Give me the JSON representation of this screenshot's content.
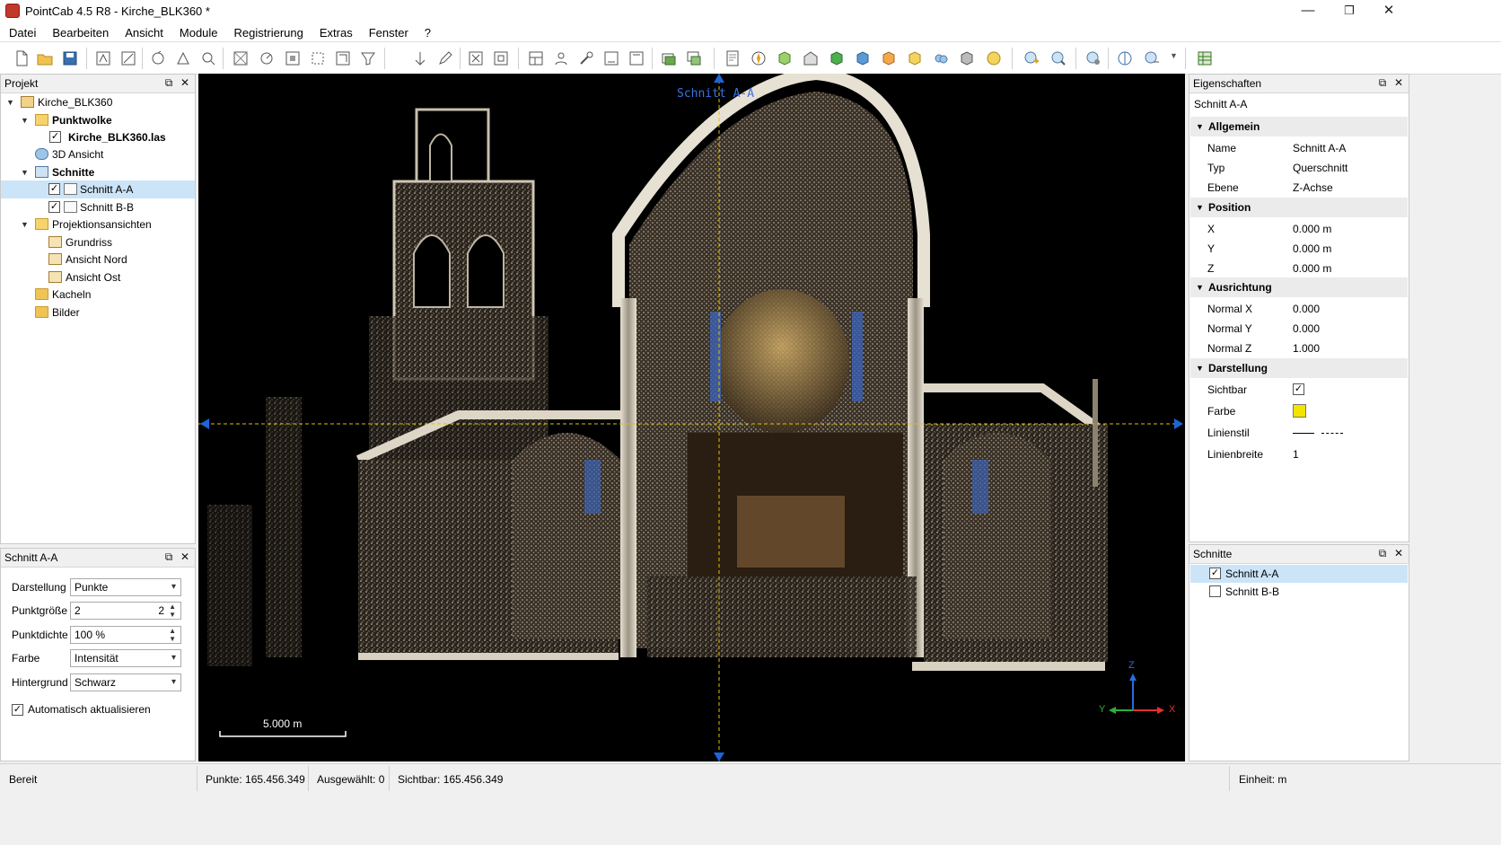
{
  "window": {
    "title": "PointCab 4.5 R8 - Kirche_BLK360 *",
    "minimize": "—",
    "maximize": "❐",
    "close": "✕"
  },
  "menu": [
    "Datei",
    "Bearbeiten",
    "Ansicht",
    "Module",
    "Registrierung",
    "Extras",
    "Fenster",
    "?"
  ],
  "project_panel": {
    "title": "Projekt",
    "tree": {
      "root": "Kirche_BLK360",
      "pointcloud_folder": "Punktwolke",
      "pointcloud_file": "Kirche_BLK360.las",
      "view3d": "3D Ansicht",
      "sections_folder": "Schnitte",
      "section_a": "Schnitt A-A",
      "section_b": "Schnitt B-B",
      "projections_folder": "Projektionsansichten",
      "grundriss": "Grundriss",
      "ansicht_nord": "Ansicht Nord",
      "ansicht_ost": "Ansicht Ost",
      "kacheln": "Kacheln",
      "bilder": "Bilder"
    }
  },
  "section_panel": {
    "title": "Schnitt A-A",
    "darstellung": {
      "label": "Darstellung",
      "value": "Punkte"
    },
    "punktgroesse": {
      "label": "Punktgröße",
      "value": "2",
      "value_right": "2"
    },
    "punktdichte": {
      "label": "Punktdichte",
      "value": "100 %"
    },
    "farbe": {
      "label": "Farbe",
      "value": "Intensität"
    },
    "hintergrund": {
      "label": "Hintergrund",
      "value": "Schwarz"
    },
    "auto_update": {
      "label": "Automatisch aktualisieren",
      "checked": true
    }
  },
  "viewport": {
    "section_label": "Schnitt A-A",
    "scale_label": "5.000 m",
    "axis_z": "Z",
    "axis_y": "Y",
    "axis_x": "X"
  },
  "properties_panel": {
    "title": "Eigenschaften",
    "object_name": "Schnitt A-A",
    "categories": {
      "allgemein": {
        "label": "Allgemein",
        "rows": [
          {
            "name": "Name",
            "value": "Schnitt A-A"
          },
          {
            "name": "Typ",
            "value": "Querschnitt"
          },
          {
            "name": "Ebene",
            "value": "Z-Achse"
          }
        ]
      },
      "position": {
        "label": "Position",
        "rows": [
          {
            "name": "X",
            "value": "0.000 m"
          },
          {
            "name": "Y",
            "value": "0.000 m"
          },
          {
            "name": "Z",
            "value": "0.000 m"
          }
        ]
      },
      "ausrichtung": {
        "label": "Ausrichtung",
        "rows": [
          {
            "name": "Normal X",
            "value": "0.000"
          },
          {
            "name": "Normal Y",
            "value": "0.000"
          },
          {
            "name": "Normal Z",
            "value": "1.000"
          }
        ]
      },
      "darstellung": {
        "label": "Darstellung",
        "sichtbar": "Sichtbar",
        "farbe": "Farbe",
        "farbe_color": "#f4e200",
        "linienstil": "Linienstil",
        "linienbreite": "Linienbreite",
        "linienbreite_value": "1"
      }
    }
  },
  "sections_panel": {
    "title": "Schnitte",
    "items": [
      {
        "label": "Schnitt A-A",
        "checked": true
      },
      {
        "label": "Schnitt B-B",
        "checked": false
      }
    ]
  },
  "statusbar": {
    "status": "Bereit",
    "punkte": "Punkte:  165.456.349",
    "ausgewaehlt": "Ausgewählt:  0",
    "sichtbar": "Sichtbar:  165.456.349",
    "einheit": "Einheit: m"
  },
  "colors": {
    "accent_blue": "#1e64d8",
    "guide_yellow": "#e0c000",
    "selection": "#cce4f7"
  }
}
